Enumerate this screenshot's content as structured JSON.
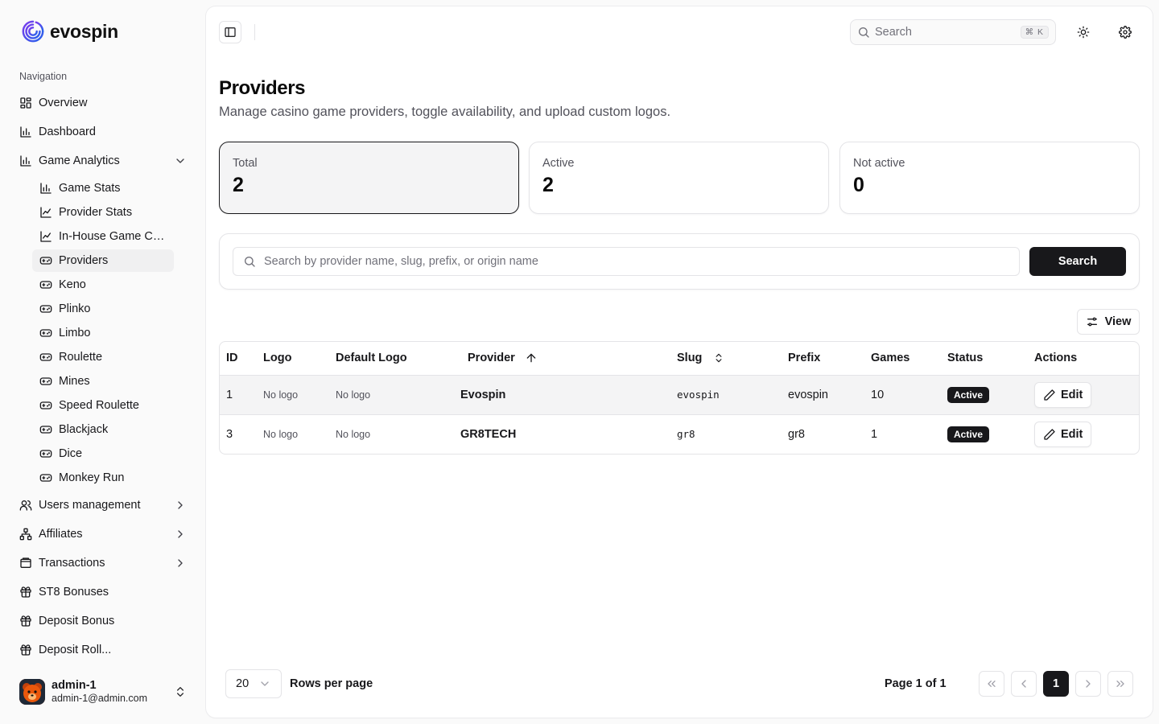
{
  "brand": {
    "name": "evospin"
  },
  "sidebar": {
    "group_label": "Navigation",
    "items": [
      {
        "label": "Overview",
        "icon": "layout-grid-icon"
      },
      {
        "label": "Dashboard",
        "icon": "bar-chart-icon"
      },
      {
        "label": "Game Analytics",
        "icon": "bar-chart-icon",
        "expanded": true
      }
    ],
    "sub_items": [
      {
        "label": "Game Stats",
        "icon": "bar-chart-icon"
      },
      {
        "label": "Provider Stats",
        "icon": "line-chart-icon"
      },
      {
        "label": "In-House Game Ch...",
        "icon": "line-chart-icon"
      },
      {
        "label": "Providers",
        "icon": "gamepad-icon",
        "active": true
      },
      {
        "label": "Keno",
        "icon": "gamepad-icon"
      },
      {
        "label": "Plinko",
        "icon": "gamepad-icon"
      },
      {
        "label": "Limbo",
        "icon": "gamepad-icon"
      },
      {
        "label": "Roulette",
        "icon": "gamepad-icon"
      },
      {
        "label": "Mines",
        "icon": "gamepad-icon"
      },
      {
        "label": "Speed Roulette",
        "icon": "gamepad-icon"
      },
      {
        "label": "Blackjack",
        "icon": "gamepad-icon"
      },
      {
        "label": "Dice",
        "icon": "gamepad-icon"
      },
      {
        "label": "Monkey Run",
        "icon": "gamepad-icon"
      }
    ],
    "more_items": [
      {
        "label": "Users management",
        "icon": "users-icon"
      },
      {
        "label": "Affiliates",
        "icon": "network-icon"
      },
      {
        "label": "Transactions",
        "icon": "wallet-icon"
      },
      {
        "label": "ST8 Bonuses",
        "icon": "gift-icon"
      },
      {
        "label": "Deposit Bonus",
        "icon": "gift-icon"
      },
      {
        "label": "Deposit Roll...",
        "icon": "gift-icon"
      }
    ],
    "user": {
      "name": "admin-1",
      "email": "admin-1@admin.com"
    }
  },
  "topbar": {
    "search_placeholder": "Search",
    "search_shortcut": "⌘ K"
  },
  "page": {
    "title": "Providers",
    "subtitle": "Manage casino game providers, toggle availability, and upload custom logos."
  },
  "stats": [
    {
      "label": "Total",
      "value": "2"
    },
    {
      "label": "Active",
      "value": "2"
    },
    {
      "label": "Not active",
      "value": "0"
    }
  ],
  "filter": {
    "placeholder": "Search by provider name, slug, prefix, or origin name",
    "button_label": "Search"
  },
  "view_button": "View",
  "table": {
    "columns": [
      "ID",
      "Logo",
      "Default Logo",
      "Provider",
      "Slug",
      "Prefix",
      "Games",
      "Status",
      "Actions"
    ],
    "rows": [
      {
        "id": "1",
        "logo": "No logo",
        "default_logo": "No logo",
        "provider": "Evospin",
        "slug": "evospin",
        "prefix": "evospin",
        "games": "10",
        "status": "Active",
        "action": "Edit"
      },
      {
        "id": "3",
        "logo": "No logo",
        "default_logo": "No logo",
        "provider": "GR8TECH",
        "slug": "gr8",
        "prefix": "gr8",
        "games": "1",
        "status": "Active",
        "action": "Edit"
      }
    ]
  },
  "pagination": {
    "rows_per_page": "20",
    "rows_per_page_label": "Rows per page",
    "page_info": "Page 1 of 1",
    "current_page": "1"
  },
  "colors": {
    "primary": "#18181b",
    "brand_logo": "#4f46e5",
    "muted": "#52525b",
    "border": "#e4e4e7"
  }
}
